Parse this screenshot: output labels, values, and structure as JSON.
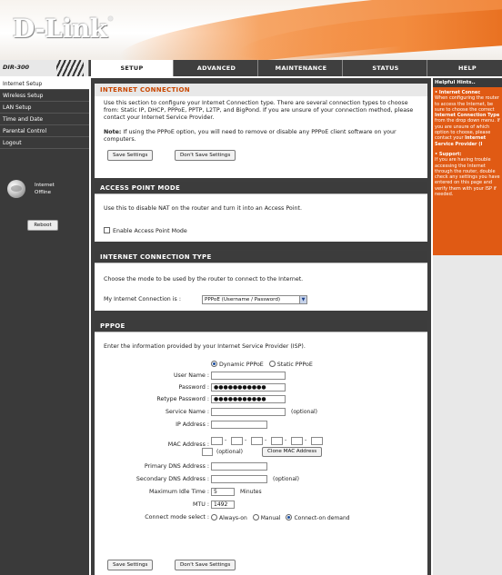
{
  "brand": {
    "logo": "D-Link",
    "model": "DIR-300"
  },
  "nav": {
    "tabs": [
      "SETUP",
      "ADVANCED",
      "MAINTENANCE",
      "STATUS",
      "HELP"
    ]
  },
  "sidebar": {
    "items": [
      "Internet Setup",
      "Wireless Setup",
      "LAN Setup",
      "Time and Date",
      "Parental Control",
      "Logout"
    ],
    "status_line1": "Internet",
    "status_line2": "Offline",
    "reboot": "Reboot"
  },
  "internet_connection": {
    "title": "INTERNET CONNECTION",
    "intro": "Use this section to configure your Internet Connection type. There are several connection types to choose from: Static IP, DHCP, PPPoE, PPTP, L2TP, and BigPond. If you are unsure of your connection method, please contact your Internet Service Provider.",
    "note_label": "Note:",
    "note": " If using the PPPoE option, you will need to remove or disable any PPPoE client software on your computers.",
    "save": "Save Settings",
    "dont_save": "Don't Save Settings"
  },
  "access_point": {
    "title": "ACCESS POINT MODE",
    "desc": "Use this to disable NAT on the router and turn it into an Access Point.",
    "checkbox_label": "Enable Access Point Mode"
  },
  "connection_type": {
    "title": "INTERNET CONNECTION TYPE",
    "desc": "Choose the mode to be used by the router to connect to the Internet.",
    "label": "My Internet Connection is :",
    "selected": "PPPoE (Username / Password)"
  },
  "pppoe": {
    "title": "PPPOE",
    "desc": "Enter the information provided by your Internet Service Provider (ISP).",
    "mode_dynamic": "Dynamic PPPoE",
    "mode_static": "Static PPPoE",
    "user_name": "User Name :",
    "password": "Password :",
    "password_value": "●●●●●●●●●●●",
    "retype_password": "Retype Password :",
    "retype_value": "●●●●●●●●●●●",
    "service_name": "Service Name :",
    "optional": "(optional)",
    "ip_address": "IP Address :",
    "mac_address": "MAC Address :",
    "mac_optional": "(optional)",
    "clone_mac": "Clone MAC Address",
    "primary_dns": "Primary DNS Address :",
    "secondary_dns": "Secondary DNS Address :",
    "idle_time": "Maximum Idle Time :",
    "idle_value": "5",
    "minutes": "Minutes",
    "mtu": "MTU :",
    "mtu_value": "1492",
    "connect_mode": "Connect mode select :",
    "always_on": "Always-on",
    "manual": "Manual",
    "on_demand": "Connect-on demand",
    "save": "Save Settings",
    "dont_save": "Don't Save Settings"
  },
  "help": {
    "title": "Helpful Hints..",
    "bullet1_title": "• Internet Connec",
    "bullet1_text": "When configuring the router to access the Internet, be sure to choose the correct",
    "bullet1_bold": "Internet Connection Type",
    "bullet1_text2": "from the drop down menu. If you are unsure of which option to choose, please contact your",
    "bullet1_bold2": "Internet Service Provider (I",
    "bullet2_title": "• Support:",
    "bullet2_text": "If you are having trouble accessing the Internet through the router, double check any settings you have entered on this page and verify them with your ISP if needed."
  }
}
